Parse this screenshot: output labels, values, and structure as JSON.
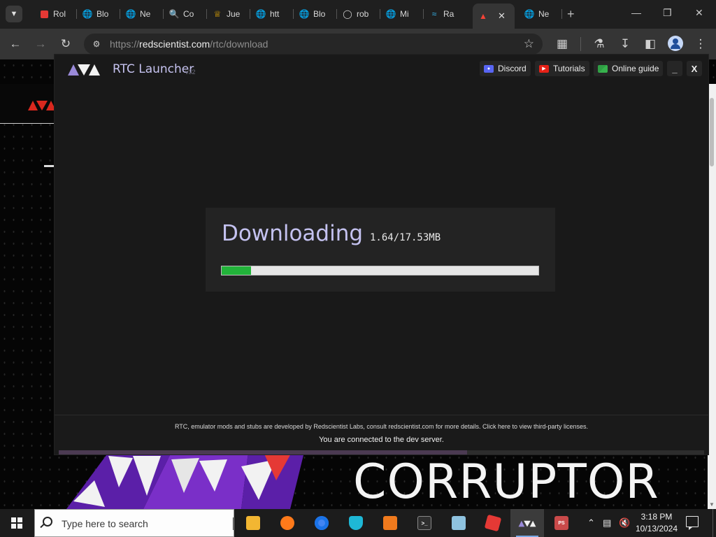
{
  "browser": {
    "tabs": [
      {
        "label": "Rol",
        "icon": "roblox-icon",
        "color": "#e53935"
      },
      {
        "label": "Blo",
        "icon": "globe-icon",
        "color": "#cfcfcf"
      },
      {
        "label": "Ne",
        "icon": "globe-icon",
        "color": "#cfcfcf"
      },
      {
        "label": "Co",
        "icon": "search-icon",
        "color": "#4285f4"
      },
      {
        "label": "Jue",
        "icon": "crown-icon",
        "color": "#f4b400"
      },
      {
        "label": "htt",
        "icon": "globe-icon",
        "color": "#cfcfcf"
      },
      {
        "label": "Blo",
        "icon": "globe-icon",
        "color": "#cfcfcf"
      },
      {
        "label": "rob",
        "icon": "github-icon",
        "color": "#cfcfcf"
      },
      {
        "label": "Mi",
        "icon": "globe-icon",
        "color": "#cfcfcf"
      },
      {
        "label": "Ra",
        "icon": "tailwind-icon",
        "color": "#38bdf8"
      },
      {
        "label": "",
        "icon": "warning-triangle-icon",
        "color": "#f44336",
        "active": true
      },
      {
        "label": "Ne",
        "icon": "globe-icon",
        "color": "#cfcfcf"
      }
    ],
    "url_scheme": "https://",
    "url_host": "redscientist.com",
    "url_path": "/rtc/download"
  },
  "launcher": {
    "title": "RTC Launcher",
    "version": "v32",
    "header_buttons": [
      {
        "label": "Discord",
        "icon": "discord-icon"
      },
      {
        "label": "Tutorials",
        "icon": "youtube-icon"
      },
      {
        "label": "Online guide",
        "icon": "guide-icon"
      }
    ],
    "minimize_label": "_",
    "close_label": "X",
    "download": {
      "title": "Downloading",
      "size_text": "1.64/17.53MB",
      "downloaded_mb": 1.64,
      "total_mb": 17.53,
      "accent_color": "#22b33a"
    },
    "footer_legal": "RTC, emulator mods and stubs are developed by Redscientist Labs, consult redscientist.com for more details. Click here to view third-party licenses.",
    "footer_status": "You are connected to the dev server."
  },
  "webpage": {
    "hero_title": "CORRUPTOR",
    "brand_color": "#d9281e"
  },
  "taskbar": {
    "search_placeholder": "Type here to search",
    "apps": [
      {
        "name": "file-explorer",
        "color": "#f2b632",
        "glyph": ""
      },
      {
        "name": "firefox",
        "color": "#ff7a1a",
        "glyph": ""
      },
      {
        "name": "chrome",
        "color": "#4285f4",
        "glyph": ""
      },
      {
        "name": "vpn",
        "color": "#1eb8d6",
        "glyph": ""
      },
      {
        "name": "flask-app",
        "color": "#f07a1d",
        "glyph": ""
      },
      {
        "name": "terminal",
        "color": "#2f2f2f",
        "glyph": ">_"
      },
      {
        "name": "notepad",
        "color": "#8fc3e0",
        "glyph": ""
      },
      {
        "name": "roblox",
        "color": "#e53935",
        "glyph": ""
      },
      {
        "name": "rtc-launcher",
        "color": "#8a6cd8",
        "glyph": "",
        "active": true
      },
      {
        "name": "ps-app",
        "color": "#c94a4a",
        "glyph": "PS"
      }
    ],
    "time": "3:18 PM",
    "date": "10/13/2024"
  }
}
